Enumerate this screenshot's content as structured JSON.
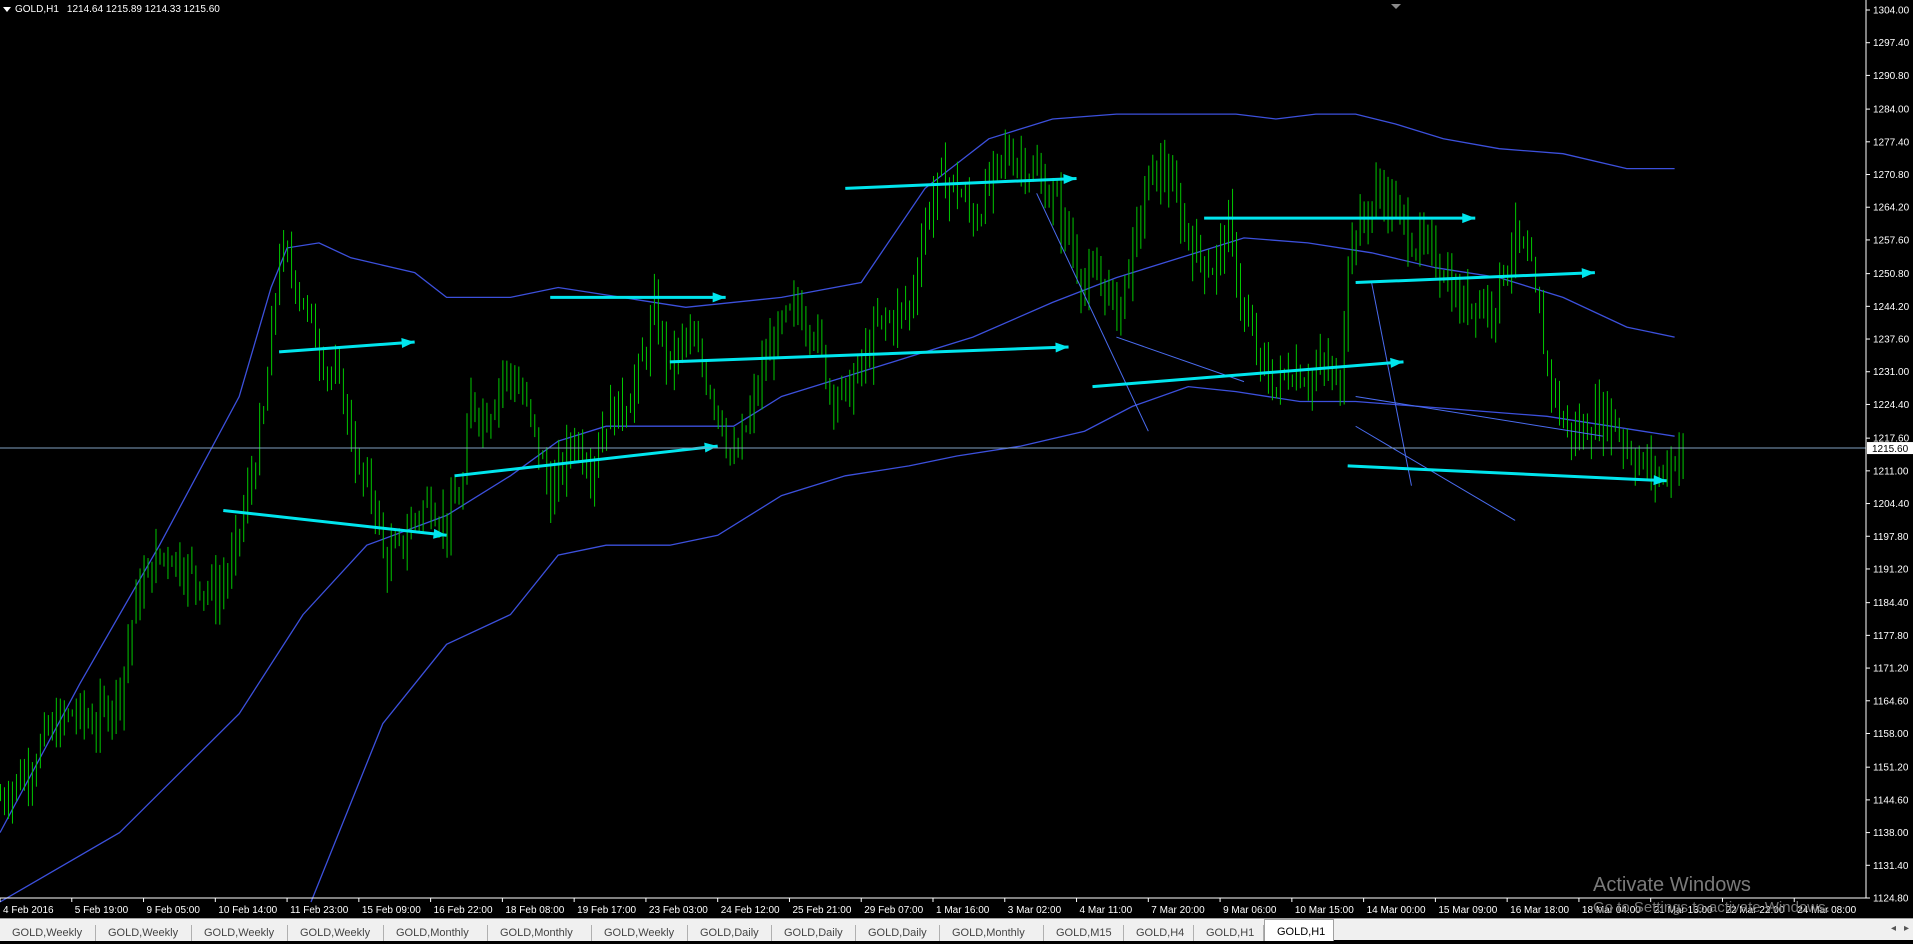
{
  "header": {
    "symbol": "GOLD,H1",
    "ohlc": "1214.64 1215.89 1214.33 1215.60"
  },
  "watermark": {
    "line1": "Activate Windows",
    "line2": "Go to Settings to activate Windows."
  },
  "tabs": [
    {
      "label": "GOLD,Weekly",
      "active": false
    },
    {
      "label": "GOLD,Weekly",
      "active": false
    },
    {
      "label": "GOLD,Weekly",
      "active": false
    },
    {
      "label": "GOLD,Weekly",
      "active": false
    },
    {
      "label": "GOLD,Monthly",
      "active": false
    },
    {
      "label": "GOLD,Monthly",
      "active": false
    },
    {
      "label": "GOLD,Weekly",
      "active": false
    },
    {
      "label": "GOLD,Daily",
      "active": false
    },
    {
      "label": "GOLD,Daily",
      "active": false
    },
    {
      "label": "GOLD,Daily",
      "active": false
    },
    {
      "label": "GOLD,Monthly",
      "active": false
    },
    {
      "label": "GOLD,M15",
      "active": false
    },
    {
      "label": "GOLD,H4",
      "active": false
    },
    {
      "label": "GOLD,H1",
      "active": false
    },
    {
      "label": "GOLD,H1",
      "active": true
    }
  ],
  "tab_scroll": {
    "left": "◂",
    "right": "▸"
  },
  "colors": {
    "background": "#000000",
    "candles": "#00c800",
    "bands": "#3c50dc",
    "arrows": "#00e6ee",
    "trendlines": "#4a6cf0",
    "priceline": "#7fa0c0",
    "axis": "#ffffff"
  },
  "chart_data": {
    "type": "line",
    "ylim": [
      1124.8,
      1304.0
    ],
    "yticks": [
      1304.0,
      1297.4,
      1290.8,
      1284.0,
      1277.4,
      1270.8,
      1264.2,
      1257.6,
      1250.8,
      1244.2,
      1237.6,
      1231.0,
      1224.4,
      1217.6,
      1211.0,
      1204.4,
      1197.8,
      1191.2,
      1184.4,
      1177.8,
      1171.2,
      1164.6,
      1158.0,
      1151.2,
      1144.6,
      1138.0,
      1131.4,
      1124.8
    ],
    "current_price": 1215.6,
    "xticks": [
      "4 Feb 2016",
      "5 Feb 19:00",
      "9 Feb 05:00",
      "10 Feb 14:00",
      "11 Feb 23:00",
      "15 Feb 09:00",
      "16 Feb 22:00",
      "18 Feb 08:00",
      "19 Feb 17:00",
      "23 Feb 03:00",
      "24 Feb 12:00",
      "25 Feb 21:00",
      "29 Feb 07:00",
      "1 Mar 16:00",
      "3 Mar 02:00",
      "4 Mar 11:00",
      "7 Mar 20:00",
      "9 Mar 06:00",
      "10 Mar 15:00",
      "14 Mar 00:00",
      "15 Mar 09:00",
      "16 Mar 18:00",
      "18 Mar 04:00",
      "21 Mar 13:00",
      "22 Mar 22:00",
      "24 Mar 08:00"
    ],
    "price_path": [
      [
        0,
        1145
      ],
      [
        6,
        1150
      ],
      [
        12,
        1158
      ],
      [
        18,
        1162
      ],
      [
        24,
        1160
      ],
      [
        30,
        1167
      ],
      [
        34,
        1185
      ],
      [
        38,
        1192
      ],
      [
        42,
        1195
      ],
      [
        48,
        1190
      ],
      [
        54,
        1186
      ],
      [
        58,
        1192
      ],
      [
        62,
        1206
      ],
      [
        66,
        1222
      ],
      [
        70,
        1255
      ],
      [
        74,
        1250
      ],
      [
        78,
        1240
      ],
      [
        82,
        1232
      ],
      [
        86,
        1226
      ],
      [
        90,
        1210
      ],
      [
        94,
        1205
      ],
      [
        96,
        1193
      ],
      [
        100,
        1195
      ],
      [
        104,
        1202
      ],
      [
        108,
        1205
      ],
      [
        112,
        1200
      ],
      [
        116,
        1208
      ],
      [
        118,
        1225
      ],
      [
        122,
        1222
      ],
      [
        126,
        1231
      ],
      [
        130,
        1228
      ],
      [
        134,
        1218
      ],
      [
        136,
        1212
      ],
      [
        138,
        1206
      ],
      [
        140,
        1210
      ],
      [
        144,
        1218
      ],
      [
        148,
        1212
      ],
      [
        152,
        1222
      ],
      [
        156,
        1224
      ],
      [
        160,
        1230
      ],
      [
        164,
        1243
      ],
      [
        168,
        1232
      ],
      [
        172,
        1238
      ],
      [
        176,
        1232
      ],
      [
        180,
        1224
      ],
      [
        184,
        1212
      ],
      [
        188,
        1222
      ],
      [
        192,
        1234
      ],
      [
        196,
        1240
      ],
      [
        200,
        1244
      ],
      [
        204,
        1240
      ],
      [
        208,
        1228
      ],
      [
        212,
        1226
      ],
      [
        216,
        1232
      ],
      [
        220,
        1240
      ],
      [
        224,
        1242
      ],
      [
        228,
        1244
      ],
      [
        232,
        1262
      ],
      [
        236,
        1270
      ],
      [
        240,
        1268
      ],
      [
        244,
        1262
      ],
      [
        248,
        1268
      ],
      [
        252,
        1275
      ],
      [
        256,
        1274
      ],
      [
        260,
        1270
      ],
      [
        264,
        1266
      ],
      [
        268,
        1258
      ],
      [
        272,
        1248
      ],
      [
        276,
        1250
      ],
      [
        280,
        1243
      ],
      [
        284,
        1255
      ],
      [
        288,
        1270
      ],
      [
        292,
        1272
      ],
      [
        296,
        1262
      ],
      [
        300,
        1255
      ],
      [
        304,
        1252
      ],
      [
        308,
        1260
      ],
      [
        312,
        1242
      ],
      [
        316,
        1232
      ],
      [
        320,
        1228
      ],
      [
        324,
        1232
      ],
      [
        328,
        1230
      ],
      [
        332,
        1232
      ],
      [
        336,
        1228
      ],
      [
        338,
        1256
      ],
      [
        342,
        1262
      ],
      [
        346,
        1268
      ],
      [
        350,
        1263
      ],
      [
        354,
        1258
      ],
      [
        358,
        1255
      ],
      [
        362,
        1252
      ],
      [
        366,
        1244
      ],
      [
        370,
        1246
      ],
      [
        374,
        1244
      ],
      [
        378,
        1254
      ],
      [
        380,
        1258
      ],
      [
        384,
        1250
      ],
      [
        388,
        1232
      ],
      [
        392,
        1220
      ],
      [
        396,
        1218
      ],
      [
        400,
        1222
      ],
      [
        404,
        1222
      ],
      [
        408,
        1216
      ],
      [
        412,
        1212
      ],
      [
        416,
        1210
      ],
      [
        420,
        1214
      ],
      [
        422,
        1215.6
      ]
    ],
    "upper_band": [
      [
        0,
        1138
      ],
      [
        20,
        1168
      ],
      [
        40,
        1196
      ],
      [
        60,
        1226
      ],
      [
        68,
        1248
      ],
      [
        72,
        1256
      ],
      [
        80,
        1257
      ],
      [
        88,
        1254
      ],
      [
        104,
        1251
      ],
      [
        112,
        1246
      ],
      [
        128,
        1246
      ],
      [
        140,
        1248
      ],
      [
        156,
        1246
      ],
      [
        172,
        1244
      ],
      [
        196,
        1246
      ],
      [
        216,
        1249
      ],
      [
        232,
        1268
      ],
      [
        248,
        1278
      ],
      [
        264,
        1282
      ],
      [
        280,
        1283
      ],
      [
        296,
        1283
      ],
      [
        310,
        1283
      ],
      [
        320,
        1282
      ],
      [
        330,
        1283
      ],
      [
        340,
        1283
      ],
      [
        350,
        1281
      ],
      [
        362,
        1278
      ],
      [
        376,
        1276
      ],
      [
        392,
        1275
      ],
      [
        408,
        1272
      ],
      [
        420,
        1272
      ]
    ],
    "middle_band": [
      [
        0,
        1124
      ],
      [
        30,
        1138
      ],
      [
        60,
        1162
      ],
      [
        76,
        1182
      ],
      [
        92,
        1196
      ],
      [
        112,
        1202
      ],
      [
        128,
        1210
      ],
      [
        140,
        1217
      ],
      [
        152,
        1220
      ],
      [
        168,
        1220
      ],
      [
        184,
        1220
      ],
      [
        196,
        1226
      ],
      [
        212,
        1230
      ],
      [
        228,
        1234
      ],
      [
        244,
        1238
      ],
      [
        264,
        1245
      ],
      [
        280,
        1250
      ],
      [
        296,
        1254
      ],
      [
        312,
        1258
      ],
      [
        328,
        1257
      ],
      [
        344,
        1255
      ],
      [
        360,
        1252
      ],
      [
        376,
        1250
      ],
      [
        392,
        1246
      ],
      [
        408,
        1240
      ],
      [
        420,
        1238
      ]
    ],
    "lower_band": [
      [
        78,
        1124
      ],
      [
        96,
        1160
      ],
      [
        112,
        1176
      ],
      [
        128,
        1182
      ],
      [
        140,
        1194
      ],
      [
        152,
        1196
      ],
      [
        168,
        1196
      ],
      [
        180,
        1198
      ],
      [
        196,
        1206
      ],
      [
        212,
        1210
      ],
      [
        228,
        1212
      ],
      [
        240,
        1214
      ],
      [
        256,
        1216
      ],
      [
        272,
        1219
      ],
      [
        284,
        1224
      ],
      [
        298,
        1228
      ],
      [
        310,
        1227
      ],
      [
        326,
        1225
      ],
      [
        340,
        1225
      ],
      [
        356,
        1224
      ],
      [
        372,
        1223
      ],
      [
        388,
        1222
      ],
      [
        404,
        1220
      ],
      [
        420,
        1218
      ]
    ],
    "arrows": [
      [
        [
          70,
          1235
        ],
        [
          104,
          1237
        ]
      ],
      [
        [
          56,
          1203
        ],
        [
          112,
          1198
        ]
      ],
      [
        [
          114,
          1210
        ],
        [
          180,
          1216
        ]
      ],
      [
        [
          138,
          1246
        ],
        [
          182,
          1246
        ]
      ],
      [
        [
          168,
          1233
        ],
        [
          268,
          1236
        ]
      ],
      [
        [
          212,
          1268
        ],
        [
          270,
          1270
        ]
      ],
      [
        [
          274,
          1228
        ],
        [
          352,
          1233
        ]
      ],
      [
        [
          302,
          1262
        ],
        [
          370,
          1262
        ]
      ],
      [
        [
          340,
          1249
        ],
        [
          400,
          1251
        ]
      ],
      [
        [
          338,
          1212
        ],
        [
          418,
          1209
        ]
      ]
    ],
    "trendlines": [
      [
        [
          260,
          1267
        ],
        [
          288,
          1219
        ]
      ],
      [
        [
          280,
          1238
        ],
        [
          312,
          1229
        ]
      ],
      [
        [
          340,
          1226
        ],
        [
          402,
          1218
        ]
      ],
      [
        [
          340,
          1220
        ],
        [
          380,
          1201
        ]
      ],
      [
        [
          344,
          1249
        ],
        [
          354,
          1208
        ]
      ]
    ]
  }
}
